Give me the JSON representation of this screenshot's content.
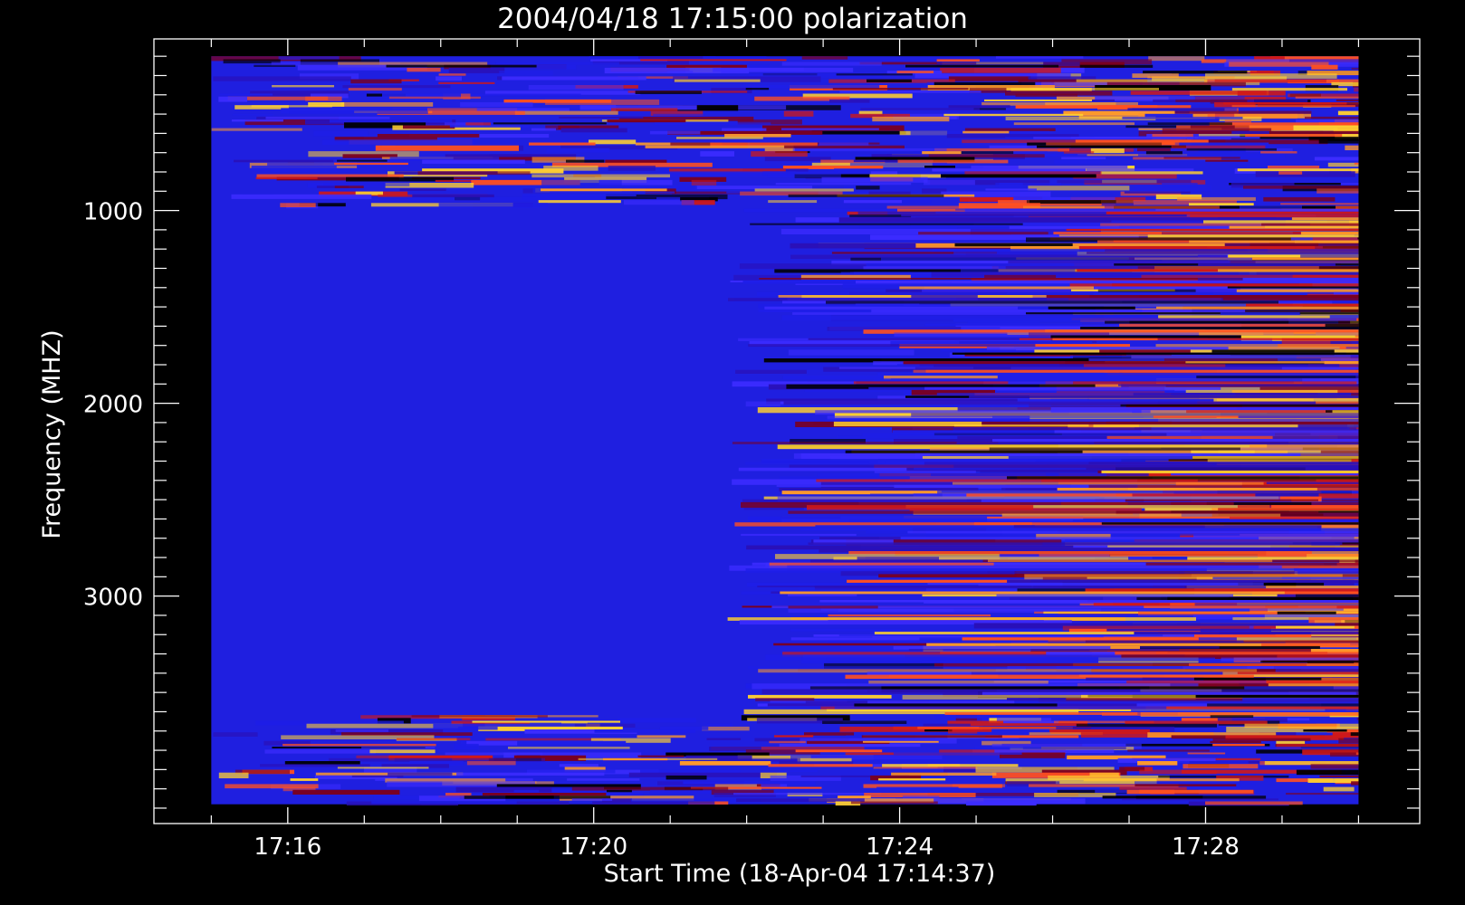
{
  "chart_data": {
    "type": "heatmap",
    "title": "2004/04/18 17:15:00 polarization",
    "xlabel": "Start Time (18-Apr-04 17:14:37)",
    "ylabel": "Frequency (MHZ)",
    "x_ticks": [
      {
        "label": "17:16",
        "minutes": 16
      },
      {
        "label": "17:20",
        "minutes": 20
      },
      {
        "label": "17:24",
        "minutes": 24
      },
      {
        "label": "17:28",
        "minutes": 28
      }
    ],
    "x_range_minutes_after_17h": [
      14.25,
      30.8
    ],
    "data_x_range_minutes_after_17h": [
      15.0,
      30.0
    ],
    "y_ticks": [
      1000,
      2000,
      3000
    ],
    "y_range_mhz": [
      110,
      4180
    ],
    "data_y_range_mhz": [
      200,
      4080
    ],
    "y_axis_inverted": true,
    "colormap": [
      "#000000",
      "#7a0020",
      "#d01818",
      "#ff5020",
      "#ff9a2a",
      "#ffd030",
      "#2a10b8",
      "#1e1ee8",
      "#3c2cff"
    ],
    "background_color": "#1f1fe0",
    "description_note": ""
  }
}
